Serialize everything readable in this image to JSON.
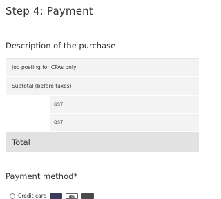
{
  "page": {
    "step_title": "Step 4: Payment"
  },
  "purchase": {
    "section_title": "Description of the purchase",
    "item_label": "Job posting for CPAs only",
    "subtotal_label": "Subtotal (before taxes)",
    "taxes": [
      {
        "label": "GST"
      },
      {
        "label": "QST"
      }
    ],
    "total_label": "Total"
  },
  "payment": {
    "section_title": "Payment method*",
    "option_label": "Credit card",
    "card_icons": [
      "visa-card-icon",
      "mastercard-icon",
      "amex-card-icon"
    ]
  }
}
